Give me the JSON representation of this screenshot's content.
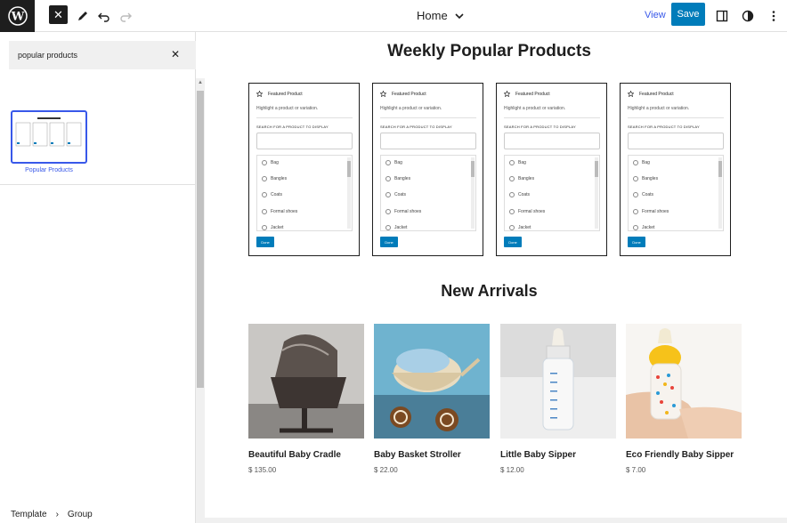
{
  "toolbar": {
    "page_title": "Home",
    "view_label": "View",
    "save_label": "Save"
  },
  "sidebar": {
    "search_value": "popular products",
    "pattern_label": "Popular Products"
  },
  "breadcrumb": [
    "Template",
    "Group"
  ],
  "canvas": {
    "weekly_heading": "Weekly Popular Products",
    "new_heading": "New Arrivals"
  },
  "featured_card": {
    "title": "Featured Product",
    "description": "Highlight a product or variation.",
    "search_label": "SEARCH FOR A PRODUCT TO DISPLAY",
    "options": [
      "Bag",
      "Bangles",
      "Coats",
      "Formal shoes",
      "Jacket"
    ],
    "done_label": "Done"
  },
  "products": [
    {
      "name": "Beautiful Baby Cradle",
      "price": "$ 135.00",
      "icon": "cradle-image"
    },
    {
      "name": "Baby Basket Stroller",
      "price": "$ 22.00",
      "icon": "stroller-image"
    },
    {
      "name": "Little Baby Sipper",
      "price": "$ 12.00",
      "icon": "sipper-image"
    },
    {
      "name": "Eco Friendly Baby Sipper",
      "price": "$ 7.00",
      "icon": "eco-sipper-image"
    }
  ],
  "colors": {
    "accent": "#007cba",
    "link": "#3858e9",
    "dark": "#1e1e1e"
  }
}
